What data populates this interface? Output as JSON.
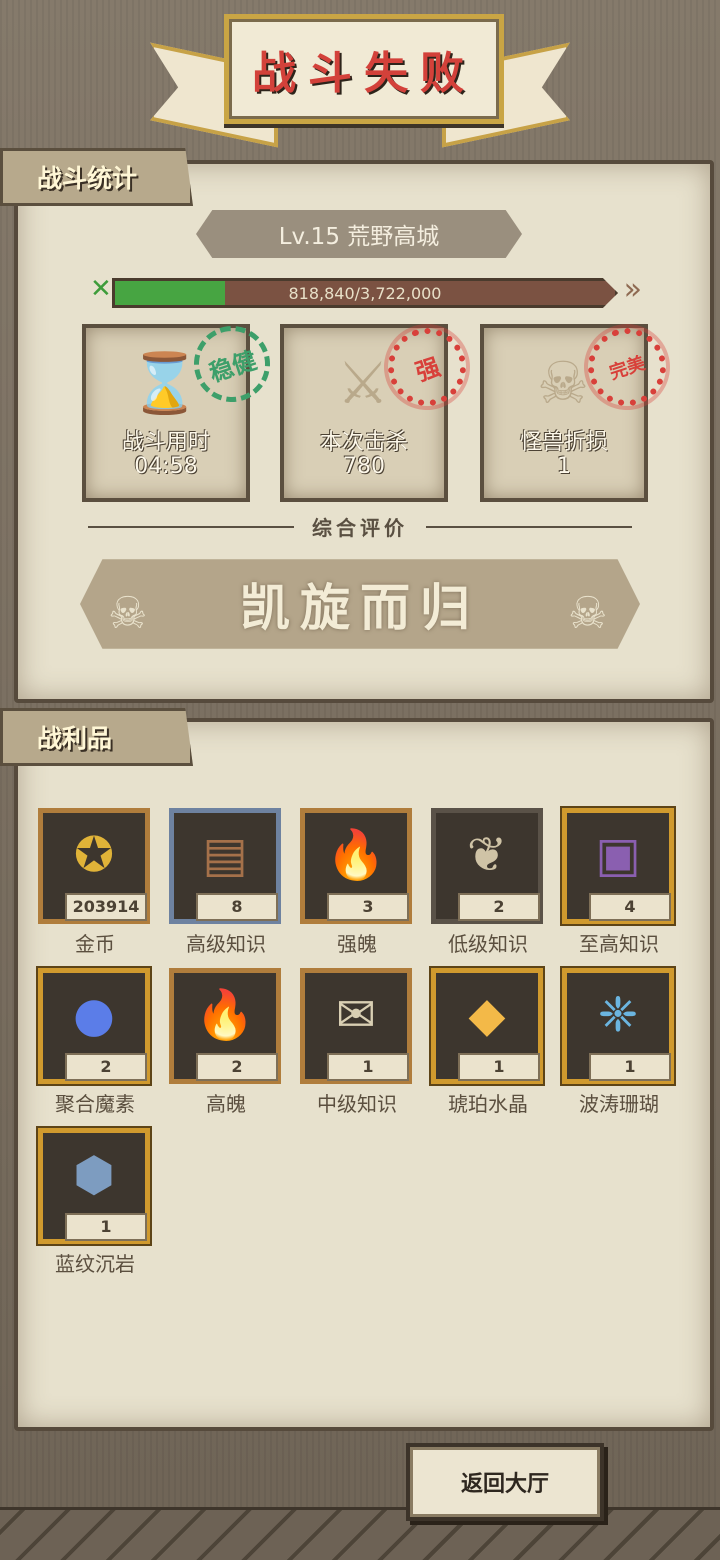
{
  "title": "战斗失败",
  "stats_section": {
    "tab_label": "战斗统计",
    "level_title": "Lv.15 荒野高城",
    "progress": {
      "current": 818840,
      "max": 3722000,
      "text": "818,840/3,722,000",
      "fraction": 0.22
    },
    "cards": [
      {
        "label": "战斗用时",
        "value": "04:58",
        "icon": "hourglass-icon",
        "stamp": "稳健",
        "stamp_color": "#3d9f6a"
      },
      {
        "label": "本次击杀",
        "value": "780",
        "icon": "crossed-swords-icon",
        "stamp": "强",
        "stamp_color": "#d8403a"
      },
      {
        "label": "怪兽折损",
        "value": "1",
        "icon": "beast-skull-icon",
        "stamp": "完美",
        "stamp_color": "#d8403a"
      }
    ],
    "rating_label": "综合评价",
    "rating_value": "凯旋而归"
  },
  "loot_section": {
    "tab_label": "战利品",
    "items": [
      {
        "name": "金币",
        "count": "203914",
        "icon": "gold-coin-icon",
        "frame": "bronze"
      },
      {
        "name": "高级知识",
        "count": "8",
        "icon": "book-icon",
        "frame": "blue"
      },
      {
        "name": "强魄",
        "count": "3",
        "icon": "flame-icon",
        "frame": "bronze"
      },
      {
        "name": "低级知识",
        "count": "2",
        "icon": "scroll-icon",
        "frame": "dark"
      },
      {
        "name": "至高知识",
        "count": "4",
        "icon": "purple-book-icon",
        "frame": "gold"
      },
      {
        "name": "聚合魔素",
        "count": "2",
        "icon": "magic-orb-icon",
        "frame": "gold"
      },
      {
        "name": "高魄",
        "count": "2",
        "icon": "big-flame-icon",
        "frame": "bronze"
      },
      {
        "name": "中级知识",
        "count": "1",
        "icon": "rolled-scroll-icon",
        "frame": "bronze"
      },
      {
        "name": "琥珀水晶",
        "count": "1",
        "icon": "amber-crystal-icon",
        "frame": "gold"
      },
      {
        "name": "波涛珊瑚",
        "count": "1",
        "icon": "coral-icon",
        "frame": "gold"
      },
      {
        "name": "蓝纹沉岩",
        "count": "1",
        "icon": "blue-rock-icon",
        "frame": "gold"
      }
    ]
  },
  "return_button": "返回大厅"
}
